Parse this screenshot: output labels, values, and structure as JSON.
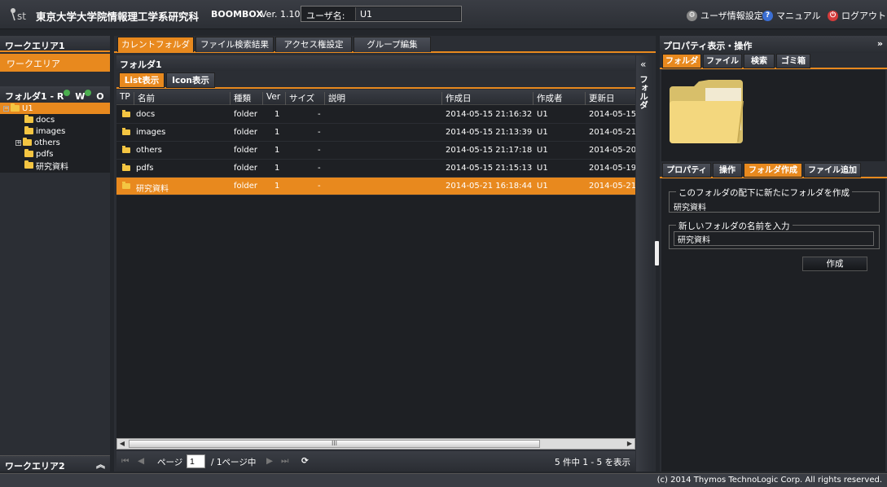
{
  "header": {
    "site_title": "東京大学大学院情報理工学系研究科",
    "app_name": "BOOMBOX",
    "version": "Ver. 1.10",
    "user_label": "ユーザ名:",
    "user_value": "U1",
    "links": {
      "user_settings": "ユーザ情報設定",
      "manual": "マニュアル",
      "logout": "ログアウト"
    }
  },
  "left": {
    "workarea1_title": "ワークエリア1",
    "workarea1_item": "ワークエリア",
    "tree_title_prefix": "フォルダ1 - R",
    "perm_w": "W",
    "perm_o": "O",
    "tree": {
      "root": "U1",
      "children": [
        "docs",
        "images",
        "others",
        "pdfs",
        "研究資料"
      ]
    },
    "workarea2_title": "ワークエリア2"
  },
  "center": {
    "tabs": [
      "カレントフォルダ",
      "ファイル検索結果",
      "アクセス権設定",
      "グループ編集"
    ],
    "folder_title": "フォルダ1",
    "view_tabs": [
      "List表示",
      "Icon表示"
    ],
    "columns": [
      "TP",
      "名前",
      "種類",
      "Ver",
      "サイズ",
      "説明",
      "作成日",
      "作成者",
      "更新日"
    ],
    "rows": [
      {
        "name": "docs",
        "type": "folder",
        "ver": "1",
        "desc": "-",
        "created": "2014-05-15 21:16:32",
        "creator": "U1",
        "updated": "2014-05-15 2"
      },
      {
        "name": "images",
        "type": "folder",
        "ver": "1",
        "desc": "-",
        "created": "2014-05-15 21:13:39",
        "creator": "U1",
        "updated": "2014-05-21 1"
      },
      {
        "name": "others",
        "type": "folder",
        "ver": "1",
        "desc": "-",
        "created": "2014-05-15 21:17:18",
        "creator": "U1",
        "updated": "2014-05-20 2"
      },
      {
        "name": "pdfs",
        "type": "folder",
        "ver": "1",
        "desc": "-",
        "created": "2014-05-15 21:15:13",
        "creator": "U1",
        "updated": "2014-05-19 2"
      },
      {
        "name": "研究資料",
        "type": "folder",
        "ver": "1",
        "desc": "-",
        "created": "2014-05-21 16:18:44",
        "creator": "U1",
        "updated": "2014-05-21 1"
      }
    ],
    "selected_row_index": 4,
    "pager": {
      "page_label": "ページ",
      "page_value": "1",
      "of_label": "/ 1ページ中",
      "summary": "5 件中 1 - 5 を表示"
    },
    "side_label": "フォルダ",
    "scroll_grip": "III"
  },
  "right": {
    "title": "プロパティ表示・操作",
    "tabs": [
      "フォルダ",
      "ファイル",
      "検索",
      "ゴミ箱"
    ],
    "action_tabs": [
      "プロパティ",
      "操作",
      "フォルダ作成",
      "ファイル追加"
    ],
    "info_legend": "このフォルダの配下に新たにフォルダを作成",
    "info_value": "研究資料",
    "name_legend": "新しいフォルダの名前を入力",
    "name_value": "研究資料",
    "create_button": "作成"
  },
  "footer": {
    "copyright": "(c) 2014 Thymos TechnoLogic Corp. All rights reserved."
  },
  "colors": {
    "accent": "#e8891e",
    "panel": "#2b2e34",
    "dark": "#1e2024",
    "folder": "#f4c542"
  }
}
